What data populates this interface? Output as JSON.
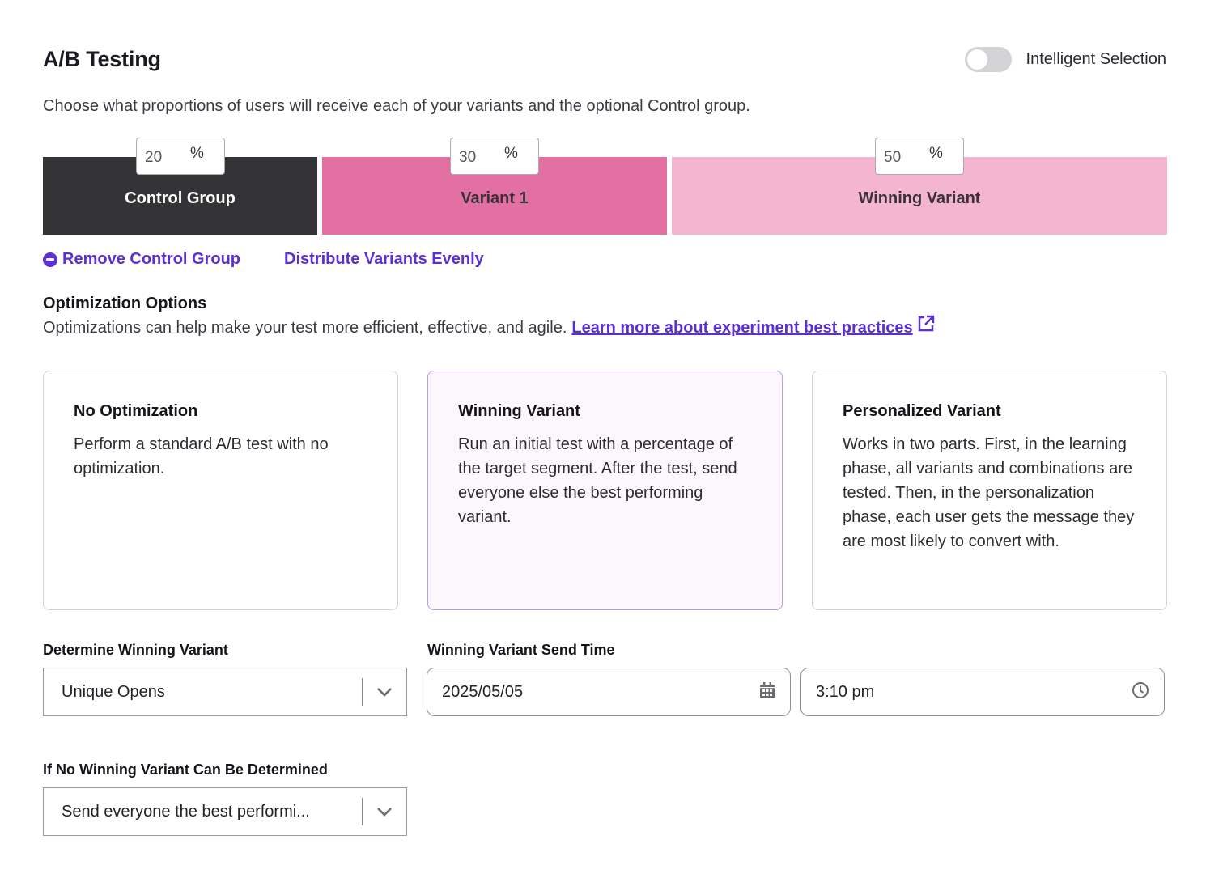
{
  "header": {
    "title": "A/B Testing",
    "toggle_label": "Intelligent Selection",
    "toggle_on": false,
    "subtitle": "Choose what proportions of users will receive each of your variants and the optional Control group."
  },
  "split": {
    "segments": [
      {
        "label": "Control Group",
        "percent": "20",
        "unit": "%",
        "color": "#343437"
      },
      {
        "label": "Variant 1",
        "percent": "30",
        "unit": "%",
        "color": "#e270a2"
      },
      {
        "label": "Winning Variant",
        "percent": "50",
        "unit": "%",
        "color": "#f4b5d3"
      }
    ]
  },
  "actions": {
    "remove_control": "Remove Control Group",
    "distribute": "Distribute Variants Evenly"
  },
  "optimization": {
    "heading": "Optimization Options",
    "description": "Optimizations can help make your test more efficient, effective, and agile.",
    "learn_more": "Learn more about experiment best practices",
    "cards": [
      {
        "title": "No Optimization",
        "description": "Perform a standard A/B test with no optimization.",
        "selected": false
      },
      {
        "title": "Winning Variant",
        "description": "Run an initial test with a percentage of the target segment. After the test, send everyone else the best performing variant.",
        "selected": true
      },
      {
        "title": "Personalized Variant",
        "description": "Works in two parts. First, in the learning phase, all variants and combinations are tested. Then, in the personalization phase, each user gets the message they are most likely to convert with.",
        "selected": false
      }
    ]
  },
  "form": {
    "determine_label": "Determine Winning Variant",
    "determine_value": "Unique Opens",
    "send_time_label": "Winning Variant Send Time",
    "date_value": "2025/05/05",
    "time_value": "3:10 pm",
    "fallback_label": "If No Winning Variant Can Be Determined",
    "fallback_value": "Send everyone the best performi..."
  },
  "colors": {
    "accent": "#5c2fd6",
    "selected_border": "#b99be6"
  }
}
